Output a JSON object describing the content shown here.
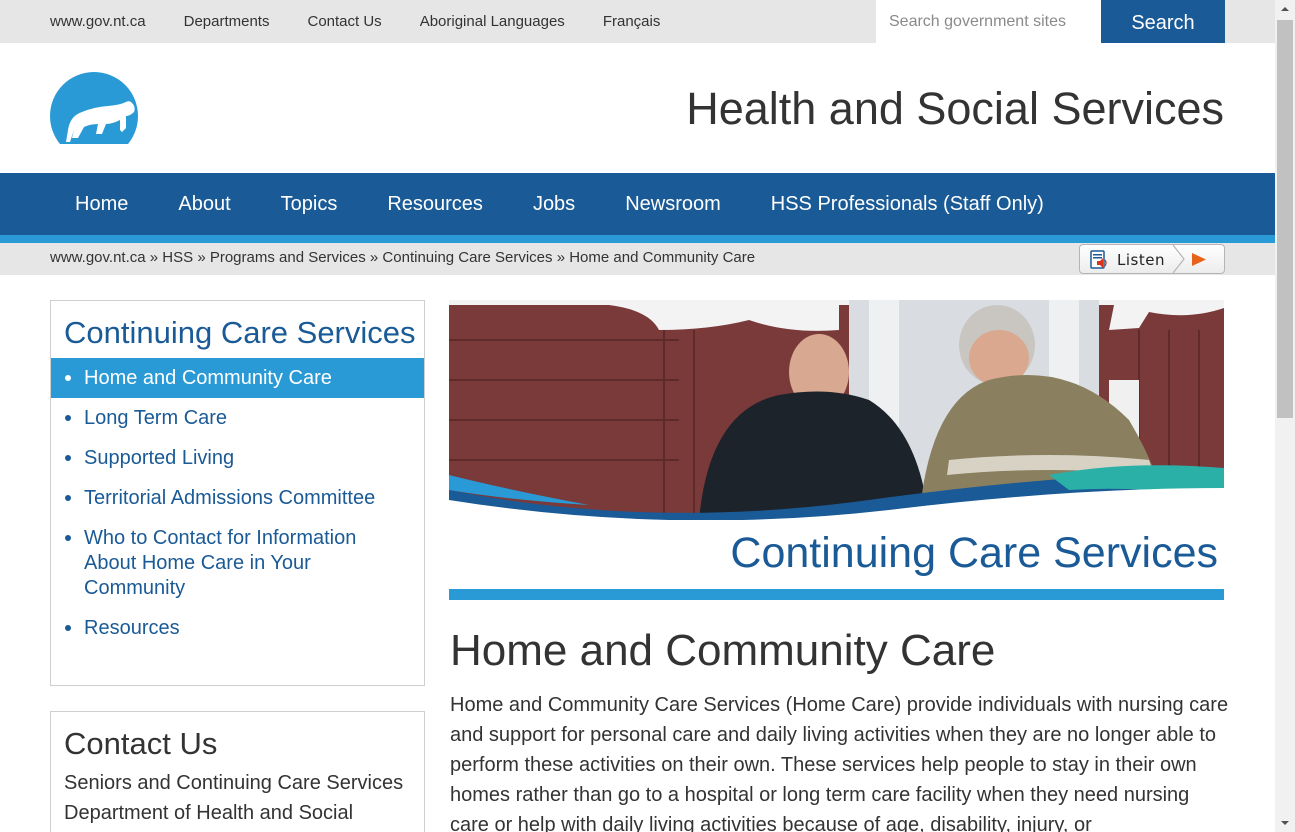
{
  "topbar": {
    "links": [
      "www.gov.nt.ca",
      "Departments",
      "Contact Us",
      "Aboriginal Languages",
      "Français"
    ],
    "search_placeholder": "Search government sites",
    "search_button": "Search"
  },
  "header": {
    "logo_icon": "polar-bear-logo-icon",
    "site_title": "Health and Social Services"
  },
  "main_nav": {
    "items": [
      "Home",
      "About",
      "Topics",
      "Resources",
      "Jobs",
      "Newsroom",
      "HSS Professionals (Staff Only)"
    ]
  },
  "breadcrumb": {
    "items": [
      "www.gov.nt.ca",
      "HSS",
      "Programs and Services",
      "Continuing Care Services",
      "Home and Community Care"
    ],
    "separator": "»",
    "listen_label": "Listen"
  },
  "sidebar": {
    "title": "Continuing Care Services",
    "items": [
      {
        "label": "Home and Community Care",
        "active": true
      },
      {
        "label": "Long Term Care",
        "active": false
      },
      {
        "label": "Supported Living",
        "active": false
      },
      {
        "label": "Territorial Admissions Committee",
        "active": false
      },
      {
        "label": "Who to Contact for Information About Home Care in Your Community",
        "active": false
      },
      {
        "label": "Resources",
        "active": false
      }
    ]
  },
  "contact": {
    "title": "Contact Us",
    "lines": [
      "Seniors and Continuing Care Services",
      "Department of Health and Social"
    ]
  },
  "banner": {
    "title": "Continuing Care Services"
  },
  "content": {
    "heading": "Home and Community Care",
    "body": "Home and Community Care Services (Home Care) provide individuals with nursing care and support for personal care and daily living activities when they are no longer able to perform these activities on their own. These services help people to stay in their own homes rather than go to a hospital or long term care facility when they need nursing care or help with daily living activities because of age, disability, injury, or"
  },
  "colors": {
    "primary": "#1a5a96",
    "accent": "#2a9ad6",
    "bar_gray": "#e6e6e6"
  }
}
